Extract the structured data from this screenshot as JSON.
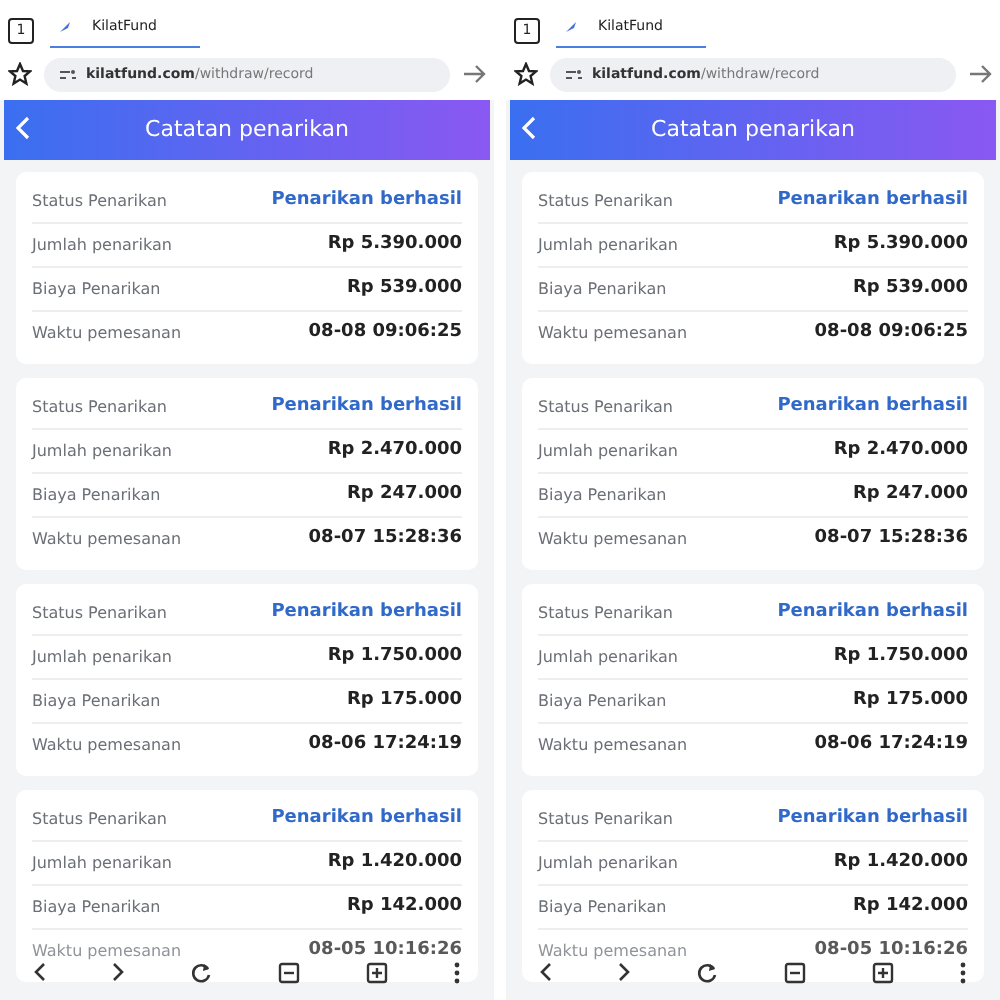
{
  "panels": [
    {
      "tab_count": "1",
      "tab_title": "KilatFund",
      "url_host": "kilatfund.com",
      "url_path": "/withdraw/record",
      "title": "Catatan penarikan",
      "records": [
        {
          "rows": [
            {
              "label": "Status Penarikan",
              "value": "Penarikan berhasil",
              "kind": "status"
            },
            {
              "label": "Jumlah penarikan",
              "value": "Rp 5.390.000",
              "kind": "amount"
            },
            {
              "label": "Biaya Penarikan",
              "value": "Rp 539.000",
              "kind": "amount"
            },
            {
              "label": "Waktu pemesanan",
              "value": "08-08 09:06:25",
              "kind": "amount"
            }
          ]
        },
        {
          "rows": [
            {
              "label": "Status Penarikan",
              "value": "Penarikan berhasil",
              "kind": "status"
            },
            {
              "label": "Jumlah penarikan",
              "value": "Rp 2.470.000",
              "kind": "amount"
            },
            {
              "label": "Biaya Penarikan",
              "value": "Rp 247.000",
              "kind": "amount"
            },
            {
              "label": "Waktu pemesanan",
              "value": "08-07 15:28:36",
              "kind": "amount"
            }
          ]
        },
        {
          "rows": [
            {
              "label": "Status Penarikan",
              "value": "Penarikan berhasil",
              "kind": "status"
            },
            {
              "label": "Jumlah penarikan",
              "value": "Rp 1.750.000",
              "kind": "amount"
            },
            {
              "label": "Biaya Penarikan",
              "value": "Rp 175.000",
              "kind": "amount"
            },
            {
              "label": "Waktu pemesanan",
              "value": "08-06 17:24:19",
              "kind": "amount"
            }
          ]
        },
        {
          "rows": [
            {
              "label": "Status Penarikan",
              "value": "Penarikan berhasil",
              "kind": "status"
            },
            {
              "label": "Jumlah penarikan",
              "value": "Rp 1.420.000",
              "kind": "amount"
            },
            {
              "label": "Biaya Penarikan",
              "value": "Rp 142.000",
              "kind": "amount"
            },
            {
              "label": "Waktu pemesanan",
              "value": "08-05 10:16:26",
              "kind": "amount"
            }
          ]
        }
      ]
    },
    {
      "tab_count": "1",
      "tab_title": "KilatFund",
      "url_host": "kilatfund.com",
      "url_path": "/withdraw/record",
      "title": "Catatan penarikan",
      "records": [
        {
          "rows": [
            {
              "label": "Status Penarikan",
              "value": "Penarikan berhasil",
              "kind": "status"
            },
            {
              "label": "Jumlah penarikan",
              "value": "Rp 5.390.000",
              "kind": "amount"
            },
            {
              "label": "Biaya Penarikan",
              "value": "Rp 539.000",
              "kind": "amount"
            },
            {
              "label": "Waktu pemesanan",
              "value": "08-08 09:06:25",
              "kind": "amount"
            }
          ]
        },
        {
          "rows": [
            {
              "label": "Status Penarikan",
              "value": "Penarikan berhasil",
              "kind": "status"
            },
            {
              "label": "Jumlah penarikan",
              "value": "Rp 2.470.000",
              "kind": "amount"
            },
            {
              "label": "Biaya Penarikan",
              "value": "Rp 247.000",
              "kind": "amount"
            },
            {
              "label": "Waktu pemesanan",
              "value": "08-07 15:28:36",
              "kind": "amount"
            }
          ]
        },
        {
          "rows": [
            {
              "label": "Status Penarikan",
              "value": "Penarikan berhasil",
              "kind": "status"
            },
            {
              "label": "Jumlah penarikan",
              "value": "Rp 1.750.000",
              "kind": "amount"
            },
            {
              "label": "Biaya Penarikan",
              "value": "Rp 175.000",
              "kind": "amount"
            },
            {
              "label": "Waktu pemesanan",
              "value": "08-06 17:24:19",
              "kind": "amount"
            }
          ]
        },
        {
          "rows": [
            {
              "label": "Status Penarikan",
              "value": "Penarikan berhasil",
              "kind": "status"
            },
            {
              "label": "Jumlah penarikan",
              "value": "Rp 1.420.000",
              "kind": "amount"
            },
            {
              "label": "Biaya Penarikan",
              "value": "Rp 142.000",
              "kind": "amount"
            },
            {
              "label": "Waktu pemesanan",
              "value": "08-05 10:16:26",
              "kind": "amount"
            }
          ]
        }
      ]
    }
  ]
}
